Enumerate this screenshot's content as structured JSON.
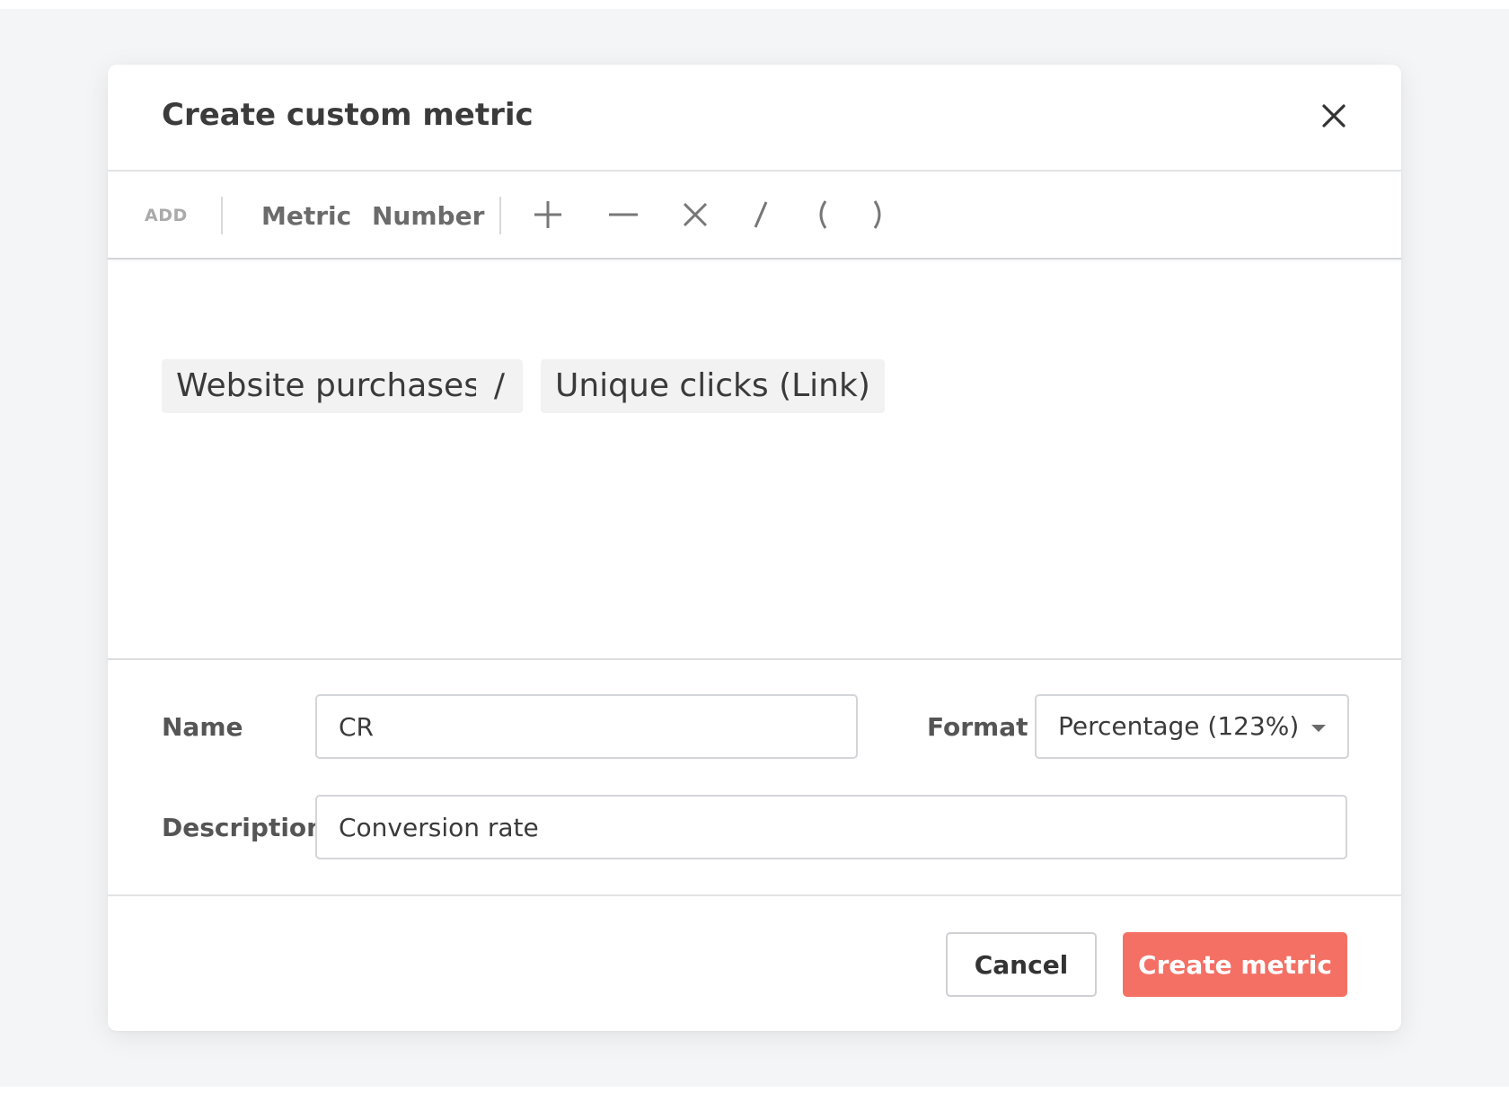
{
  "dialog": {
    "title": "Create custom metric"
  },
  "toolbar": {
    "add_label": "ADD",
    "metric_label": "Metric",
    "number_label": "Number",
    "operators": [
      "plus",
      "minus",
      "multiply",
      "divide",
      "open-paren",
      "close-paren"
    ]
  },
  "formula": {
    "tokens": [
      {
        "text": "Website purchases"
      },
      {
        "text": "/"
      },
      {
        "text": "Unique clicks (Link)"
      }
    ]
  },
  "form": {
    "name_label": "Name",
    "name_value": "CR",
    "format_label": "Format",
    "format_value": "Percentage (123%)",
    "description_label": "Description",
    "description_value": "Conversion rate"
  },
  "footer": {
    "cancel_label": "Cancel",
    "submit_label": "Create metric"
  },
  "colors": {
    "primary": "#f47065",
    "backdrop": "#f4f5f7",
    "border": "#d4d5d8"
  },
  "icons": {
    "close": "close-icon",
    "plus": "plus-icon",
    "minus": "minus-icon",
    "multiply": "multiply-icon",
    "divide": "divide-icon",
    "open_paren": "open-paren-icon",
    "close_paren": "close-paren-icon",
    "caret": "chevron-down-icon"
  }
}
